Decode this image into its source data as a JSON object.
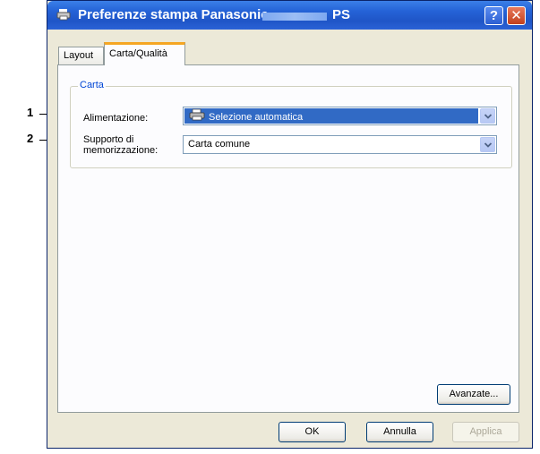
{
  "callouts": [
    "1",
    "2"
  ],
  "window": {
    "title": "Preferenze stampa Panasonic",
    "title_suffix": "PS",
    "help_glyph": "?",
    "close_glyph": "✕"
  },
  "tabs": [
    {
      "label": "Layout",
      "active": false
    },
    {
      "label": "Carta/Qualità",
      "active": true
    }
  ],
  "groupbox": {
    "label": "Carta",
    "fields": [
      {
        "label": "Alimentazione:",
        "value": "Selezione automatica",
        "icon": "printer-icon"
      },
      {
        "label_line1": "Supporto di",
        "label_line2": "memorizzazione:",
        "value": "Carta comune"
      }
    ]
  },
  "buttons": {
    "advanced": "Avanzate...",
    "ok": "OK",
    "cancel": "Annulla",
    "apply": "Applica"
  },
  "colors": {
    "titlebar": "#2563d7",
    "selection": "#316ac5",
    "tab_highlight": "#f5a623",
    "groupbox_label": "#0046d5"
  }
}
